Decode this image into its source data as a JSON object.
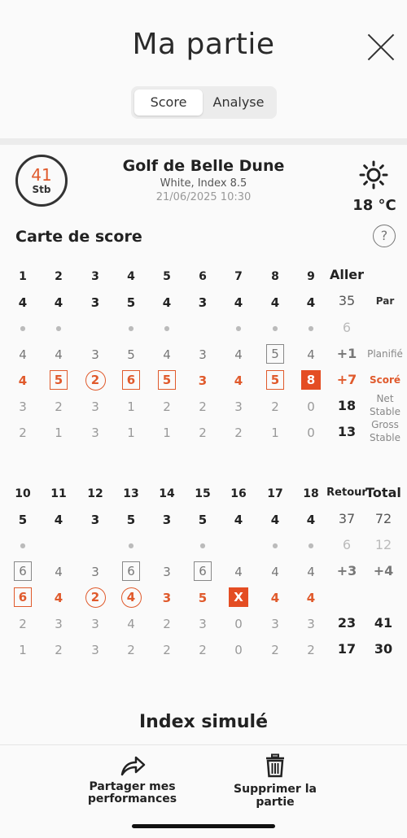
{
  "header": {
    "title": "Ma partie",
    "tabs": [
      "Score",
      "Analyse"
    ]
  },
  "summary": {
    "stableford_value": "41",
    "stableford_label": "Stb",
    "course": "Golf de Belle Dune",
    "tee_index": "White, Index 8.5",
    "datetime": "21/06/2025 10:30",
    "temperature": "18 °C"
  },
  "scorecard": {
    "title": "Carte de score",
    "help": "?",
    "front": {
      "holes": [
        "1",
        "2",
        "3",
        "4",
        "5",
        "6",
        "7",
        "8",
        "9"
      ],
      "par": [
        "4",
        "4",
        "3",
        "5",
        "4",
        "3",
        "4",
        "4",
        "4"
      ],
      "planned": [
        "4",
        "4",
        "3",
        "5",
        "4",
        "3",
        "4",
        "5",
        "4"
      ],
      "score": [
        "4",
        "5",
        "2",
        "6",
        "5",
        "3",
        "4",
        "5",
        "8"
      ],
      "net": [
        "3",
        "2",
        "3",
        "1",
        "2",
        "2",
        "3",
        "2",
        "0"
      ],
      "gross": [
        "2",
        "1",
        "3",
        "1",
        "1",
        "2",
        "2",
        "1",
        "0"
      ],
      "total_label": "Aller",
      "par_total": "35",
      "strokes_total": "6",
      "planned_total": "+1",
      "score_total": "+7",
      "net_total": "18",
      "gross_total": "13"
    },
    "back": {
      "holes": [
        "10",
        "11",
        "12",
        "13",
        "14",
        "15",
        "16",
        "17",
        "18"
      ],
      "par": [
        "5",
        "4",
        "3",
        "5",
        "3",
        "5",
        "4",
        "4",
        "4"
      ],
      "planned": [
        "6",
        "4",
        "3",
        "6",
        "3",
        "6",
        "4",
        "4",
        "4"
      ],
      "score": [
        "6",
        "4",
        "2",
        "4",
        "3",
        "5",
        "X",
        "4",
        "4"
      ],
      "net": [
        "2",
        "3",
        "3",
        "4",
        "2",
        "3",
        "0",
        "3",
        "3"
      ],
      "gross": [
        "1",
        "2",
        "3",
        "2",
        "2",
        "2",
        "0",
        "2",
        "2"
      ],
      "total_label": "Retour",
      "par_total": "37",
      "strokes_total": "6",
      "planned_total": "+3",
      "net_total": "23",
      "gross_total": "17"
    },
    "grand": {
      "label": "Total",
      "par_total": "72",
      "strokes_total": "12",
      "planned_total": "+4",
      "net_total": "41",
      "gross_total": "30"
    },
    "row_labels": {
      "par": "Par",
      "planned": "Planifié",
      "score": "Scoré",
      "net": "Net Stable",
      "gross": "Gross Stable"
    }
  },
  "simulated_index_title": "Index simulé",
  "actions": {
    "share": "Partager mes performances",
    "delete": "Supprimer la partie"
  }
}
